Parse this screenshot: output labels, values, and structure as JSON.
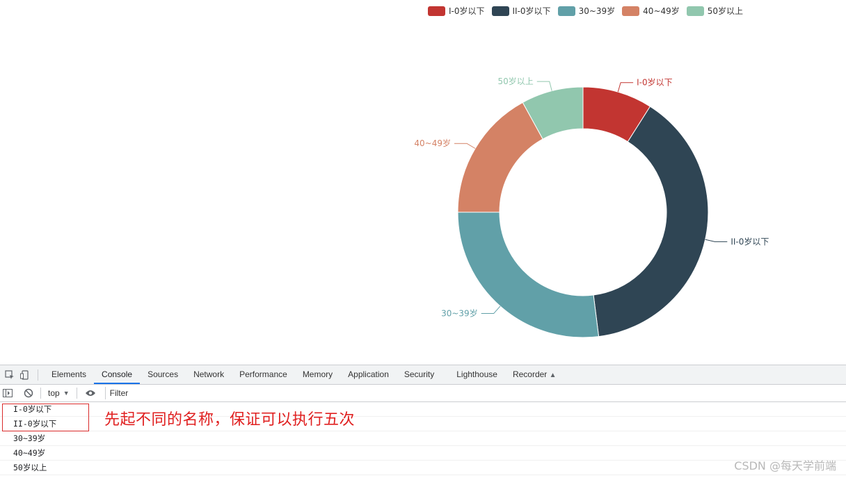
{
  "chart_data": {
    "type": "pie",
    "donut": true,
    "categories": [
      "I-0岁以下",
      "II-0岁以下",
      "30~39岁",
      "40~49岁",
      "50岁以上"
    ],
    "values": [
      9,
      39,
      27,
      17,
      8
    ],
    "colors": [
      "#c23531",
      "#2f4554",
      "#61a0a8",
      "#d48265",
      "#91c7ae"
    ],
    "legend_position": "top-right"
  },
  "devtools": {
    "tabs": [
      "Elements",
      "Console",
      "Sources",
      "Network",
      "Performance",
      "Memory",
      "Application",
      "Security",
      "Lighthouse",
      "Recorder"
    ],
    "active_tab": "Console",
    "context": "top",
    "filter_placeholder": "Filter",
    "console_lines": [
      "I-0岁以下",
      "II-0岁以下",
      "30~39岁",
      "40~49岁",
      "50岁以上"
    ]
  },
  "annotation": "先起不同的名称，保证可以执行五次",
  "watermark": "CSDN @每天学前端"
}
